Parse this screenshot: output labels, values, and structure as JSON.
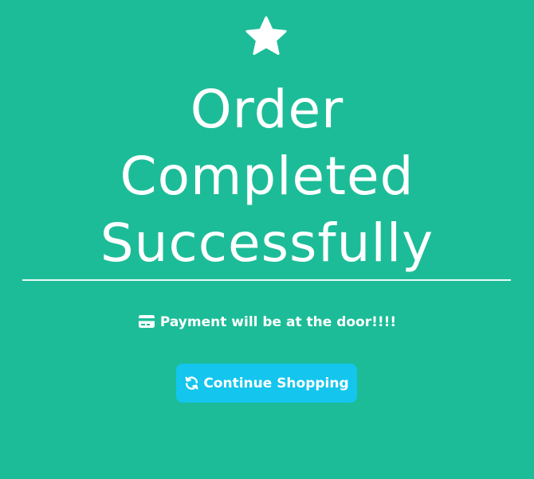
{
  "theme": {
    "background": "#1dbc98",
    "text": "#ffffff",
    "button": "#14c5ee"
  },
  "icons": {
    "top": "star-icon",
    "payment": "credit-card-icon",
    "button": "refresh-icon"
  },
  "page": {
    "title_lines": [
      "Order",
      "Completed",
      "Successfully"
    ],
    "payment_message": "Payment will be at the door!!!!",
    "continue_button_label": "Continue Shopping"
  }
}
